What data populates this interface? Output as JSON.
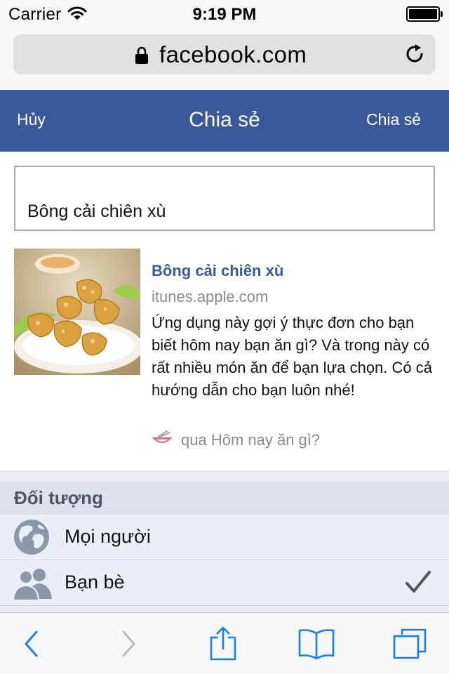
{
  "status_bar": {
    "carrier": "Carrier",
    "time": "9:19 PM"
  },
  "browser": {
    "url": "facebook.com"
  },
  "share_dialog": {
    "cancel_label": "Hủy",
    "title": "Chia sẻ",
    "share_label": "Chia sẻ",
    "message": "Bông cải chiên xù"
  },
  "link_preview": {
    "title": "Bông cải chiên xù",
    "domain": "itunes.apple.com",
    "description": "Ứng dụng này gợi ý thực đơn cho bạn biết hôm nay bạn ăn gì? Và trong này có rất nhiều món ăn để bạn lựa chọn. Có cả hướng dẫn cho bạn luôn nhé!",
    "via": "qua Hôm nay ăn gì?"
  },
  "audience": {
    "header": "Đối tượng",
    "options": [
      {
        "label": "Mọi người",
        "icon": "globe-icon",
        "selected": false
      },
      {
        "label": "Bạn bè",
        "icon": "friends-icon",
        "selected": true
      }
    ]
  },
  "toolbar": {
    "icons": [
      "back-icon",
      "forward-icon",
      "share-icon",
      "bookmarks-icon",
      "tabs-icon"
    ],
    "forward_enabled": false
  },
  "colors": {
    "facebook_blue": "#3b5998",
    "ios_tint": "#157efb",
    "section_bg": "#eceef5"
  }
}
